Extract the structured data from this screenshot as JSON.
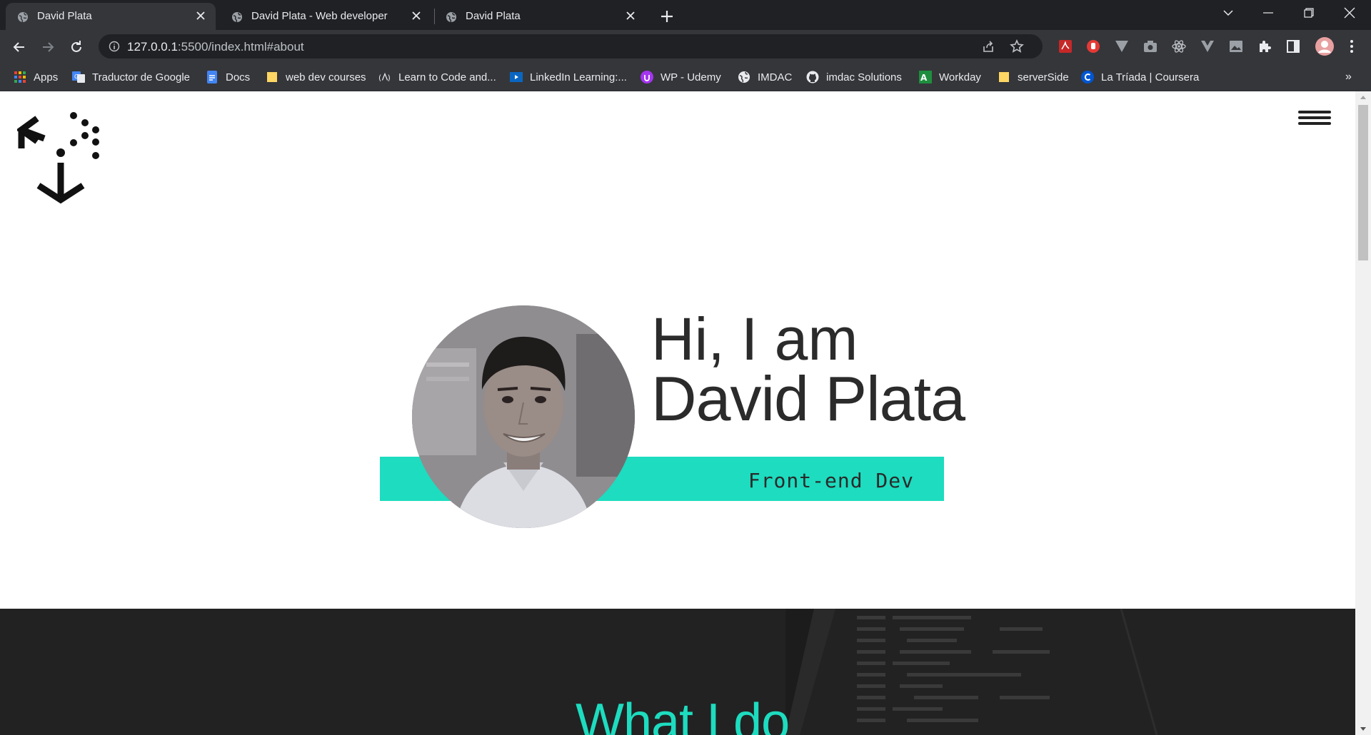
{
  "browser": {
    "tabs": [
      {
        "title": "David Plata",
        "active": true
      },
      {
        "title": "David Plata - Web developer",
        "active": false
      },
      {
        "title": "David Plata",
        "active": false
      }
    ],
    "url_host": "127.0.0.1",
    "url_rest": ":5500/index.html#about",
    "bookmarks": [
      {
        "label": "Apps",
        "icon": "apps-grid-icon"
      },
      {
        "label": "Traductor de Google",
        "icon": "google-translate-icon"
      },
      {
        "label": "Docs",
        "icon": "google-docs-icon"
      },
      {
        "label": "web dev courses",
        "icon": "folder-icon"
      },
      {
        "label": "Learn to Code and...",
        "icon": "freecodecamp-icon"
      },
      {
        "label": "LinkedIn Learning:...",
        "icon": "linkedin-learning-icon"
      },
      {
        "label": "WP - Udemy",
        "icon": "udemy-icon"
      },
      {
        "label": "IMDAC",
        "icon": "globe-icon"
      },
      {
        "label": "imdac Solutions",
        "icon": "github-icon"
      },
      {
        "label": "Workday",
        "icon": "workday-icon"
      },
      {
        "label": "serverSide",
        "icon": "folder-icon"
      },
      {
        "label": "La Tríada | Coursera",
        "icon": "coursera-icon"
      }
    ],
    "bookmarks_overflow": "»"
  },
  "page": {
    "greeting_line1": "Hi, I am",
    "greeting_line2": "David Plata",
    "role": "Front-end Dev",
    "section_title": "What I do",
    "accent_color": "#1ddcbf"
  }
}
